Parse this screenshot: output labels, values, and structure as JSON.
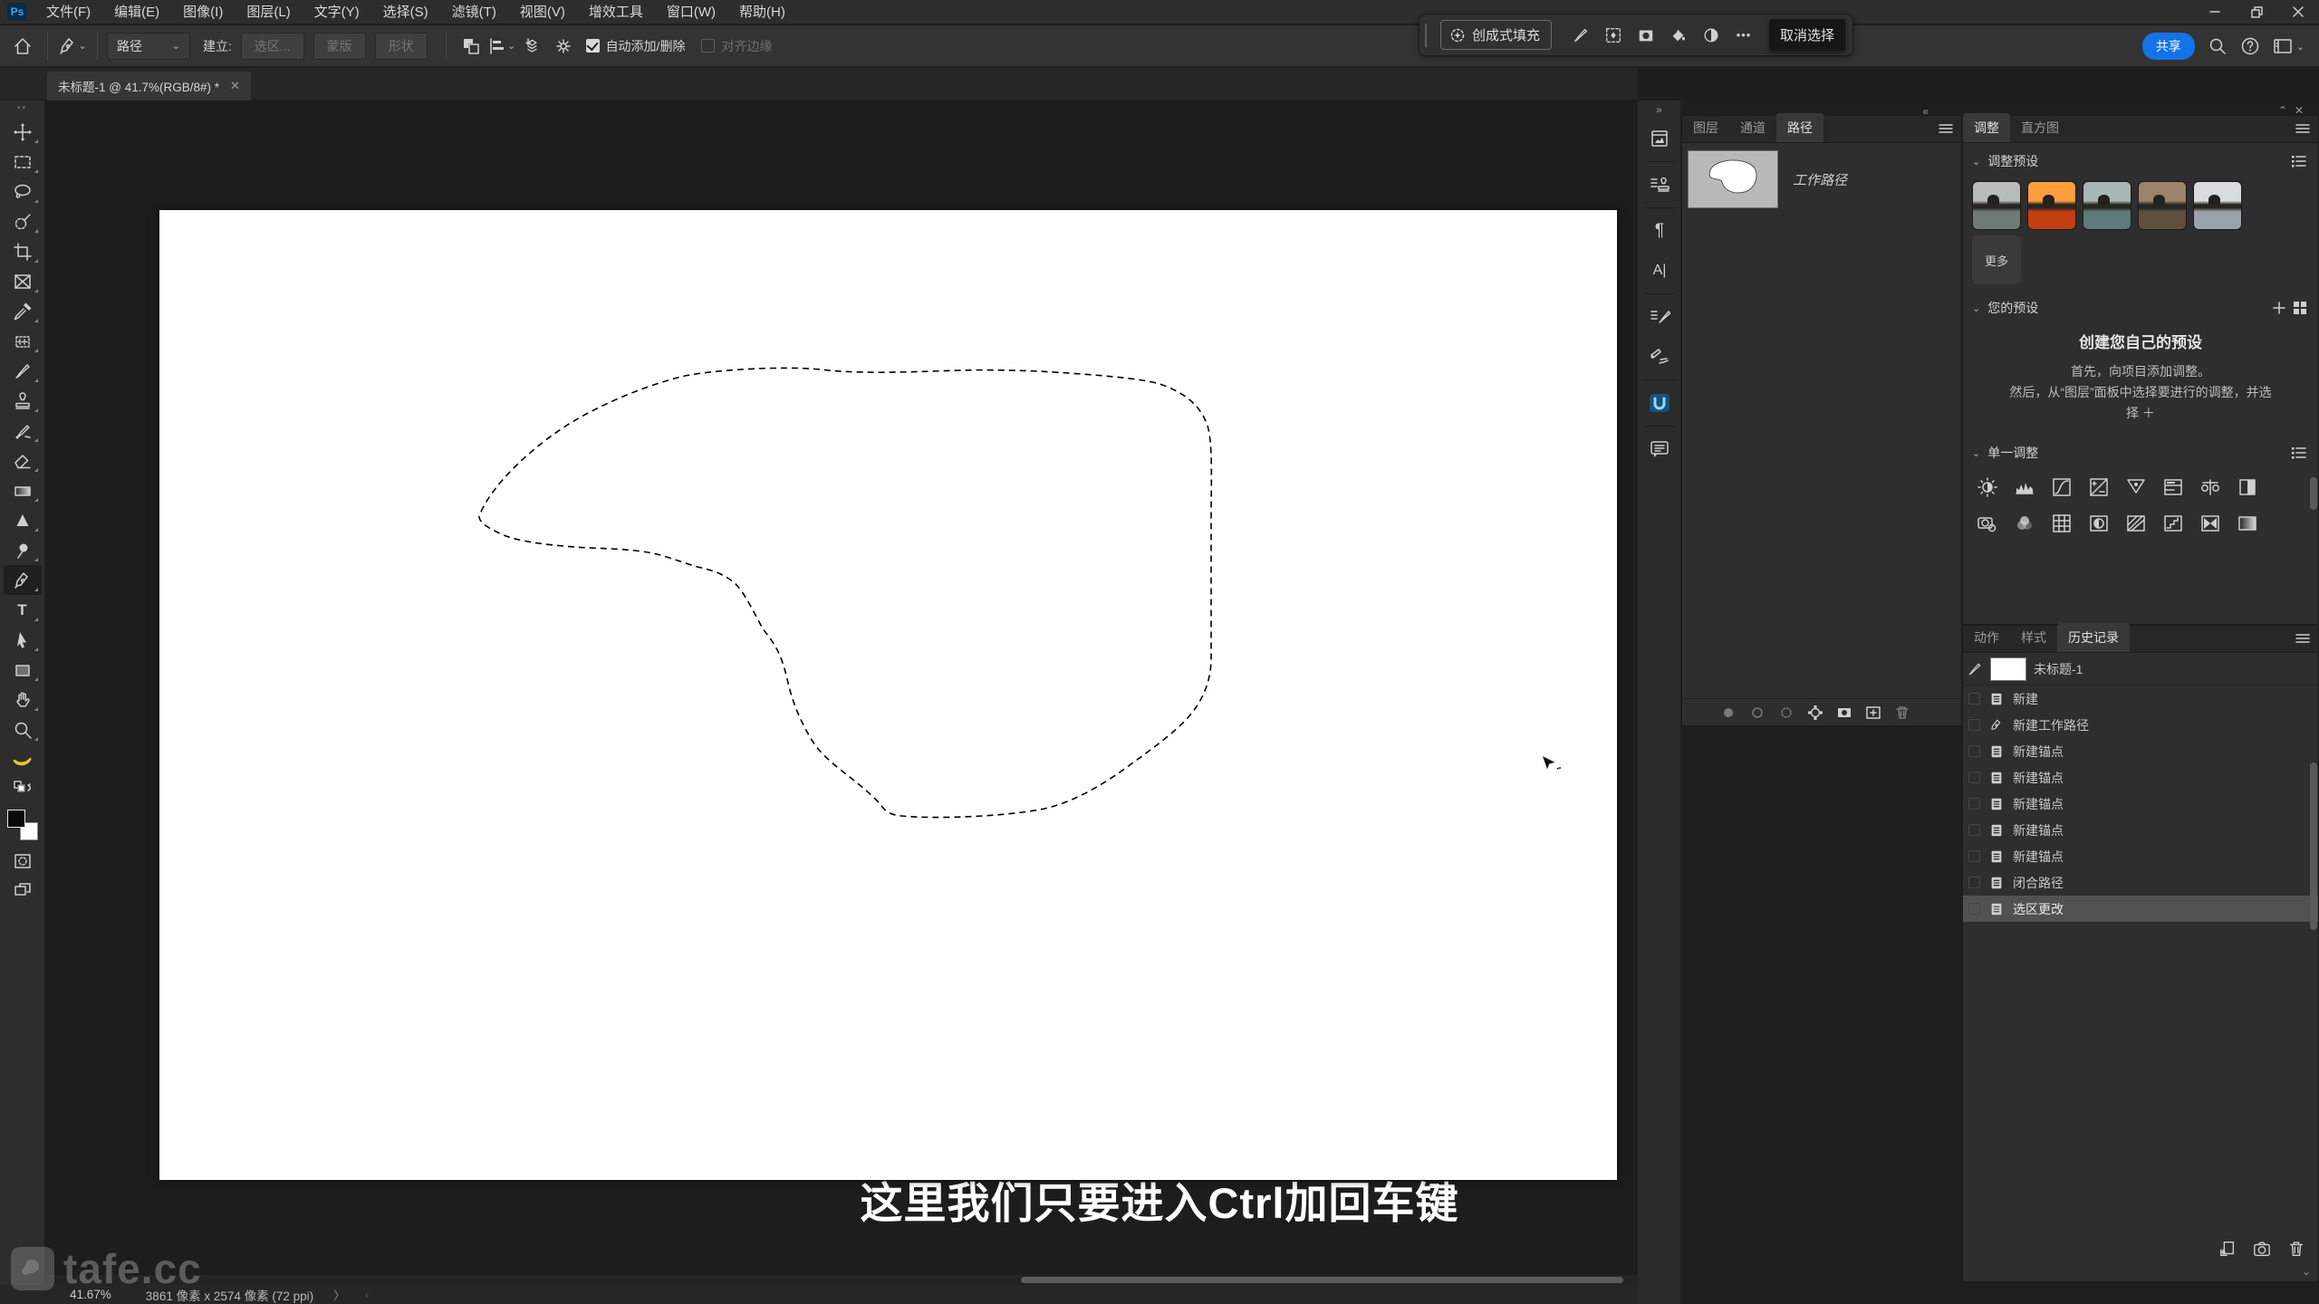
{
  "titlebar": {
    "logo": "Ps",
    "menus": [
      "文件(F)",
      "编辑(E)",
      "图像(I)",
      "图层(L)",
      "文字(Y)",
      "选择(S)",
      "滤镜(T)",
      "视图(V)",
      "增效工具",
      "窗口(W)",
      "帮助(H)"
    ]
  },
  "options": {
    "preset": "路径",
    "make_label": "建立:",
    "selection_btn": "选区...",
    "mask_btn": "蒙版",
    "shape_btn": "形状",
    "auto_adddel": "自动添加/删除",
    "align_edges": "对齐边缘"
  },
  "taskbar": {
    "generative_fill": "创成式填充",
    "deselect": "取消选择"
  },
  "header_actions": {
    "share": "共享"
  },
  "document_tab": {
    "title": "未标题-1 @ 41.7%(RGB/8#) *"
  },
  "canvas": {
    "caption": "这里我们只要进入Ctrl加回车键"
  },
  "paths_panel": {
    "tabs": [
      "图层",
      "通道",
      "路径"
    ],
    "work_path": "工作路径"
  },
  "adjustments_panel": {
    "tabs": [
      "调整",
      "直方图"
    ],
    "presets_header": "调整预设",
    "more": "更多",
    "your_presets_header": "您的预设",
    "empty_title": "创建您自己的预设",
    "empty_line1": "首先，向项目添加调整。",
    "empty_line2": "然后，从“图层”面板中选择要进行的调整，并选",
    "empty_line3": "择 ＋",
    "single_header": "单一调整",
    "preset_skies": [
      "#b8bcb9",
      "#ff9d3f",
      "#a7b7b5",
      "#9a8368",
      "#d8dcdf"
    ],
    "preset_waters": [
      "#6f7a74",
      "#c23f10",
      "#5f7a7a",
      "#5e4f3c",
      "#9aa3a9"
    ]
  },
  "history_panel": {
    "tabs": [
      "动作",
      "样式",
      "历史记录"
    ],
    "snapshot": "未标题-1",
    "entries": [
      {
        "label": "新建"
      },
      {
        "label": "新建工作路径"
      },
      {
        "label": "新建锚点"
      },
      {
        "label": "新建锚点"
      },
      {
        "label": "新建锚点"
      },
      {
        "label": "新建锚点"
      },
      {
        "label": "新建锚点"
      },
      {
        "label": "闭合路径"
      },
      {
        "label": "选区更改"
      }
    ]
  },
  "statusbar": {
    "zoom": "41.67%",
    "doc_info": "3861 像素 x 2574 像素 (72 ppi)",
    "chevron_right": "〉",
    "chevron_left": "‹"
  },
  "watermark": {
    "text": "tafe.cc"
  },
  "icons": {
    "paragraph_glyph": "¶",
    "character_glyph": "A|",
    "type_glyph": "T",
    "ellipsis_glyph": "•••",
    "dots_grip": "••",
    "collapse_right": "»",
    "collapse_left": "«",
    "chevron_down": "⌄",
    "close_glyph": "✕",
    "panel_up": "⌃"
  },
  "colors": {
    "accent_blue": "#1473e6",
    "selected_row": "#515151",
    "canvas_white": "#ffffff"
  }
}
